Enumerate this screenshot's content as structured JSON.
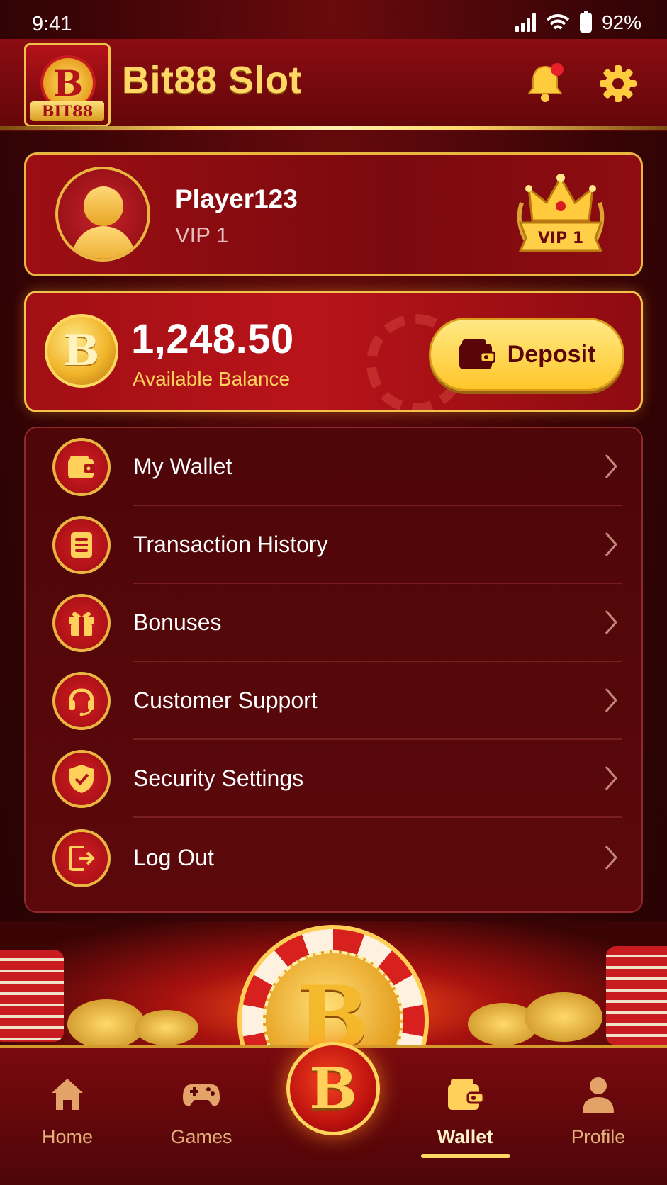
{
  "status_bar": {
    "time": "9:41",
    "battery": "92%"
  },
  "header": {
    "logo_text": "BIT88",
    "logo_symbol": "B",
    "title": "Bit88 Slot",
    "has_notification": true
  },
  "profile": {
    "username": "Player123",
    "vip_level": "VIP 1",
    "badge_text": "VIP 1"
  },
  "balance": {
    "currency_symbol": "B",
    "amount": "1,248.50",
    "label": "Available Balance",
    "deposit_label": "Deposit"
  },
  "menu": {
    "items": [
      {
        "label": "My Wallet",
        "icon": "wallet-icon"
      },
      {
        "label": "Transaction History",
        "icon": "document-icon"
      },
      {
        "label": "Bonuses",
        "icon": "gift-icon"
      },
      {
        "label": "Customer Support",
        "icon": "headset-icon"
      },
      {
        "label": "Security Settings",
        "icon": "shield-check-icon"
      },
      {
        "label": "Log Out",
        "icon": "logout-icon"
      }
    ]
  },
  "banner": {
    "symbol": "B"
  },
  "bottom_nav": {
    "center_symbol": "B",
    "items": [
      {
        "label": "Home",
        "icon": "home-icon"
      },
      {
        "label": "Games",
        "icon": "gamepad-icon"
      },
      {
        "label": "Wallet",
        "icon": "wallet-icon",
        "active": true
      },
      {
        "label": "Profile",
        "icon": "person-icon"
      }
    ]
  },
  "colors": {
    "accent_gold": "#ffd764",
    "primary_red": "#8a0d12",
    "notification_dot": "#e8202a"
  }
}
